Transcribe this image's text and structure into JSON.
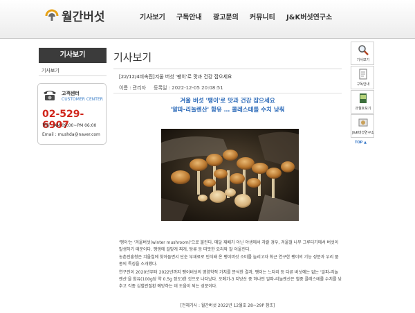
{
  "header": {
    "logo_text": "월간버섯",
    "nav": [
      "기사보기",
      "구독안내",
      "광고문의",
      "커뮤니티",
      "J&K버섯연구소"
    ]
  },
  "sidebar": {
    "title": "기사보기",
    "link": "기사보기",
    "customer_center": {
      "label": "고객센터",
      "label_en": "CUSTOMER CENTER",
      "phone": "02-529-6907",
      "hours": "평일 : AM 09:00~PM 06:00",
      "email": "Email : mushda@naver.com"
    }
  },
  "main": {
    "page_title": "기사보기",
    "article_title": "[22/12/4비속진]겨울 버섯 '팽이'로 맛과 건강 잡으세요",
    "meta": "이름 : 관리자     등록일 : 2022-12-05 20:08:51",
    "headline_1": "겨울 버섯 '팽이'로 맛과 건강 잡으세요",
    "headline_2": "'알파-리놀렌산' 함유 … 콜레스테롤 수치 낮춰",
    "paragraphs": [
      "'팽이'는 '겨울버섯(winter mushroom)'으로 불린다. 매달 재배가 아닌 야생에서 자랄 경우, 겨울철 나무 그루터기에서 버섯이 발생하기 때문이다. 팽앵에 걸맞게 찌개, 탕류 등 따뜻한 요리와 잘 어울린다.",
      "농촌진흥청은 겨울철에 찾아들면서 단순 부재료로 인식돼 온 팽이버섯 소비를 늘리고자 최근 연구한 팽이의 기능 성분과 우리 품종의 특징을 소개했다.",
      "연구진이 2020년부터 2022년까지 팽이버섯의 영양학적 가치를 분석한 결과, 팽이는 느타리 등 다른 버섯에는 없는 '알파-리놀렌산'을 함유(100g당 약 0.5g 정도)한 것으로 나타났다. 오메가-3 지방산 중 하나인 알파-리놀렌산은 혈중 콜레스테롤 수치를 낮추고 각종 심혈관질환 예방하는 데 도움이 되는 성분이다."
    ],
    "source": "[전체기사 : 월간버섯 2022년 12월호 28~29P 참조]"
  },
  "quick_menu": {
    "items": [
      "기사보기",
      "구독안내",
      "과월호보기",
      "J&K버섯연구소"
    ],
    "top": "TOP"
  },
  "colors": {
    "accent_blue": "#2a69b8",
    "phone_red": "#d0251b",
    "sidebar_dark": "#3b3b3b"
  }
}
